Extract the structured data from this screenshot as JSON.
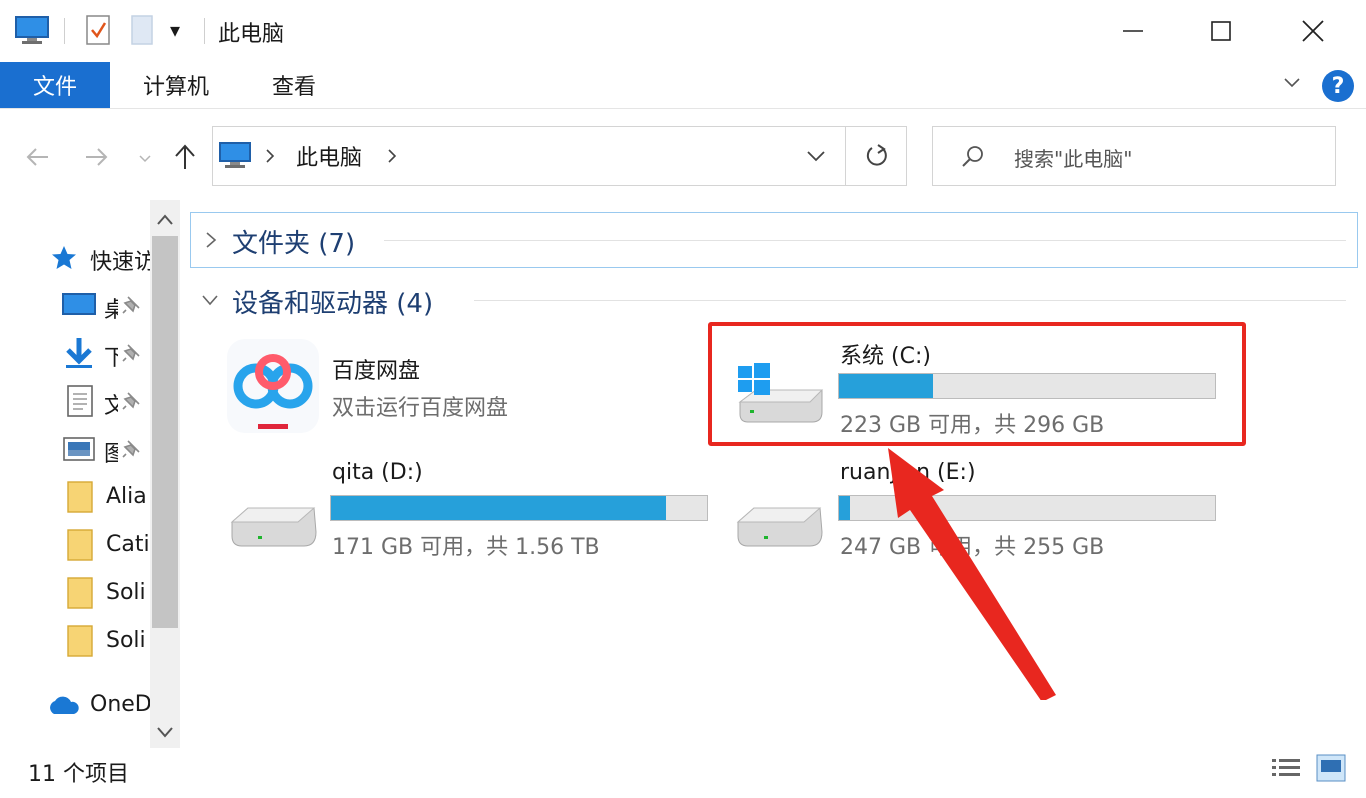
{
  "window": {
    "title": "此电脑",
    "quick_access_dropdown": "▾"
  },
  "ribbon": {
    "tabs": [
      {
        "label": "文件"
      },
      {
        "label": "计算机"
      },
      {
        "label": "查看"
      }
    ],
    "help_label": "?"
  },
  "nav": {
    "breadcrumb": "此电脑",
    "search_placeholder": "搜索\"此电脑\""
  },
  "sidebar": {
    "quick_access_label": "快速访",
    "items": [
      {
        "label": "桌",
        "icon": "desktop-icon",
        "pinned": true
      },
      {
        "label": "下",
        "icon": "download-icon",
        "pinned": true
      },
      {
        "label": "文",
        "icon": "document-icon",
        "pinned": true
      },
      {
        "label": "图",
        "icon": "picture-icon",
        "pinned": true
      },
      {
        "label": "Alia",
        "icon": "folder-icon",
        "pinned": false
      },
      {
        "label": "Cati",
        "icon": "folder-icon",
        "pinned": false
      },
      {
        "label": "Soli",
        "icon": "folder-icon",
        "pinned": false
      },
      {
        "label": "Soli",
        "icon": "folder-icon",
        "pinned": false
      }
    ],
    "onedrive_label": "OneD"
  },
  "content": {
    "folders_group": "文件夹 (7)",
    "devices_group": "设备和驱动器 (4)",
    "app_item": {
      "name": "百度网盘",
      "sub": "双击运行百度网盘"
    },
    "drives": [
      {
        "name": "系统 (C:)",
        "space": "223 GB 可用，共 296 GB",
        "used_fraction": 0.25,
        "system": true
      },
      {
        "name": "qita (D:)",
        "space": "171 GB 可用，共 1.56 TB",
        "used_fraction": 0.89,
        "system": false
      },
      {
        "name": "ruanjian (E:)",
        "space": "247 GB 可用，共 255 GB",
        "used_fraction": 0.03,
        "system": false
      }
    ]
  },
  "status": {
    "items_count": "11 个项目"
  },
  "colors": {
    "accent": "#1a6fd0",
    "bar_fill": "#26a0da",
    "highlight": "#e8271f",
    "header_text": "#1e3f72"
  }
}
